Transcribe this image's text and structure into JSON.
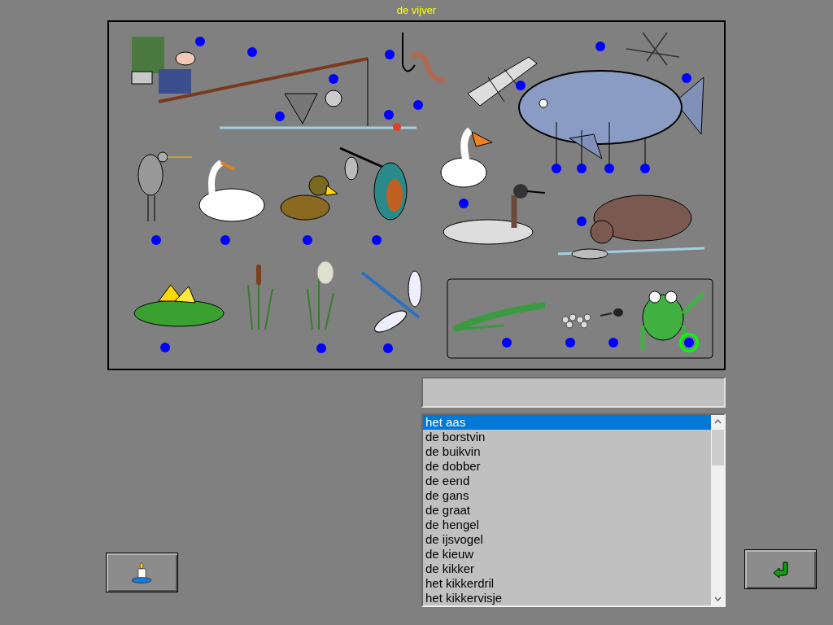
{
  "title": "de vijver",
  "markers": [
    {
      "selected": false
    },
    {
      "selected": false
    },
    {
      "selected": false
    },
    {
      "selected": false
    },
    {
      "selected": false
    },
    {
      "selected": false
    },
    {
      "selected": false
    },
    {
      "selected": false
    },
    {
      "selected": false
    },
    {
      "selected": false
    },
    {
      "selected": false
    },
    {
      "selected": false
    },
    {
      "selected": false
    },
    {
      "selected": false
    },
    {
      "selected": false
    },
    {
      "selected": false
    },
    {
      "selected": false
    },
    {
      "selected": false
    },
    {
      "selected": false
    },
    {
      "selected": false
    },
    {
      "selected": false
    },
    {
      "selected": false
    },
    {
      "selected": false
    },
    {
      "selected": false
    },
    {
      "selected": false
    },
    {
      "selected": false
    },
    {
      "selected": true
    }
  ],
  "words": [
    {
      "label": "het aas",
      "selected": true
    },
    {
      "label": "de borstvin",
      "selected": false
    },
    {
      "label": "de buikvin",
      "selected": false
    },
    {
      "label": "de dobber",
      "selected": false
    },
    {
      "label": "de eend",
      "selected": false
    },
    {
      "label": "de gans",
      "selected": false
    },
    {
      "label": "de graat",
      "selected": false
    },
    {
      "label": "de hengel",
      "selected": false
    },
    {
      "label": "de ijsvogel",
      "selected": false
    },
    {
      "label": "de kieuw",
      "selected": false
    },
    {
      "label": "de kikker",
      "selected": false
    },
    {
      "label": "het kikkerdril",
      "selected": false
    },
    {
      "label": "het kikkervisje",
      "selected": false
    }
  ]
}
